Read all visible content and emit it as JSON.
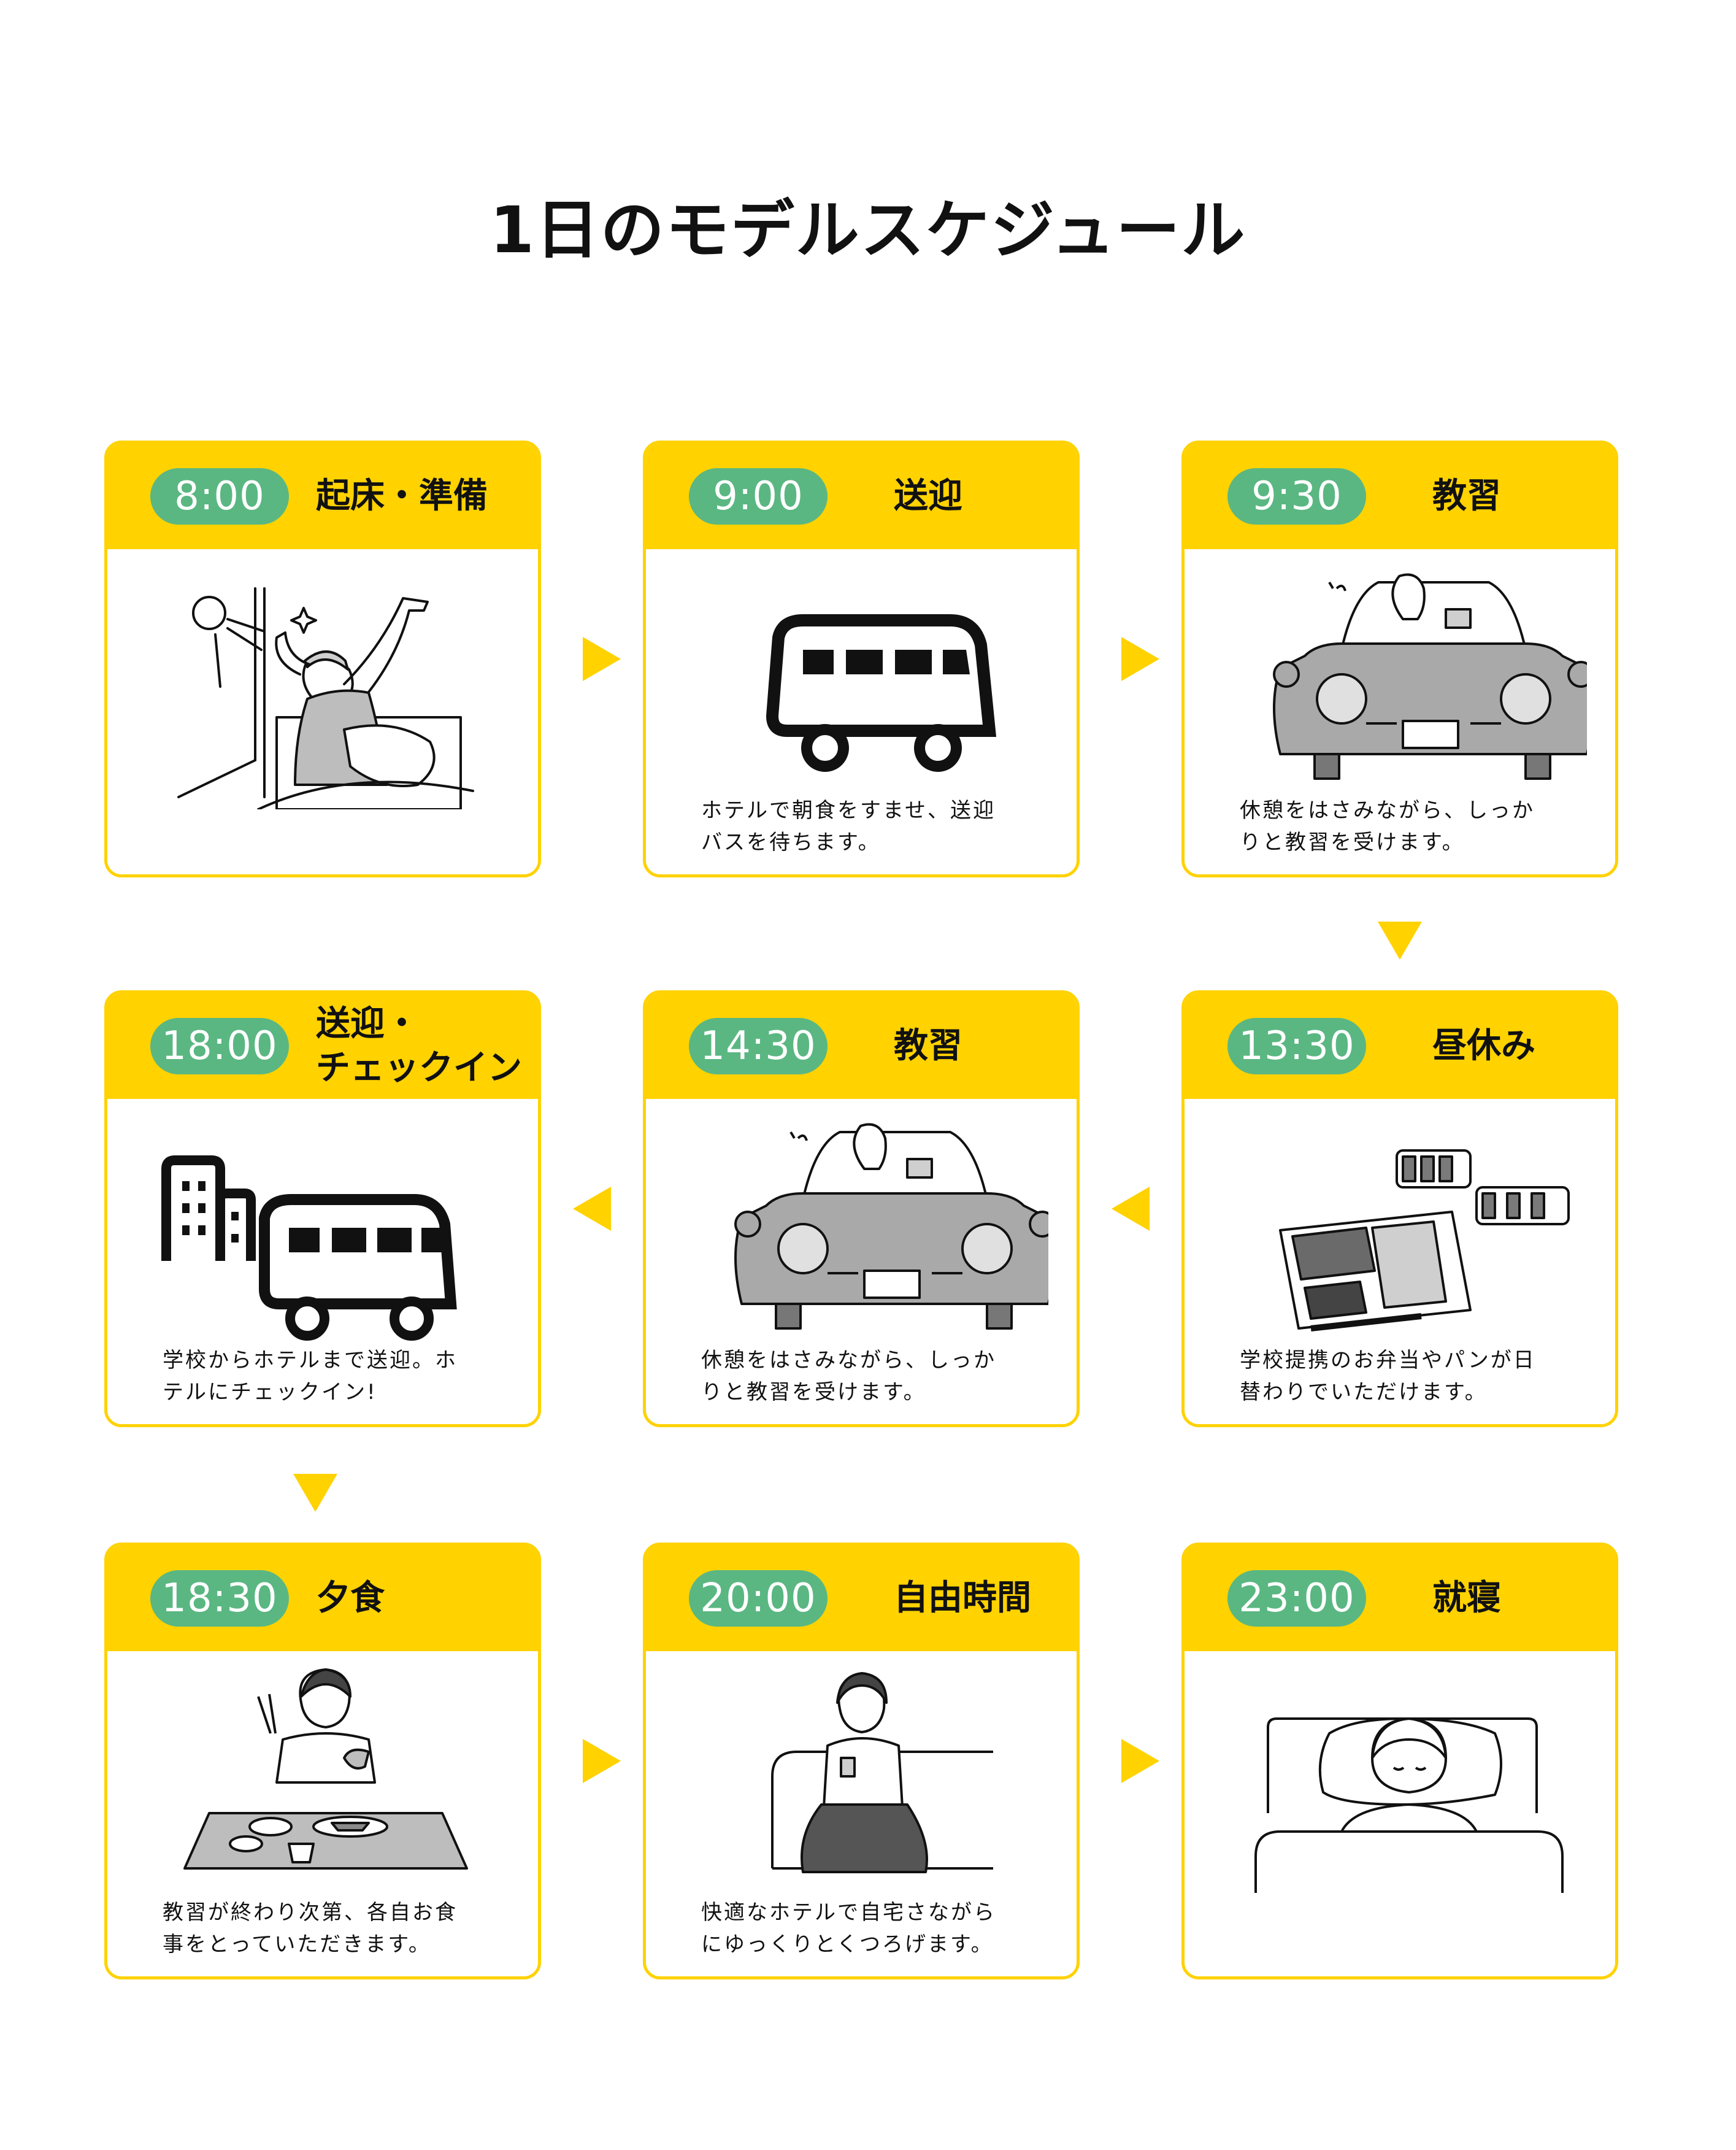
{
  "title": "1日のモデルスケジュール",
  "colors": {
    "accent_yellow": "#ffd200",
    "time_green": "#5ab782"
  },
  "cards": [
    {
      "time": "8:00",
      "activity": "起床・準備",
      "icon": "person-waking-up-illustration",
      "description": ""
    },
    {
      "time": "9:00",
      "activity": "送迎",
      "icon": "bus-icon",
      "description": "ホテルで朝食をすませ、送迎\nバスを待ちます。"
    },
    {
      "time": "9:30",
      "activity": "教習",
      "icon": "person-driving-car-illustration",
      "description": "休憩をはさみながら、しっか\nりと教習を受けます。"
    },
    {
      "time": "13:30",
      "activity": "昼休み",
      "icon": "bento-lunch-illustration",
      "description": "学校提携のお弁当やパンが日\n替わりでいただけます。"
    },
    {
      "time": "14:30",
      "activity": "教習",
      "icon": "person-driving-car-illustration",
      "description": "休憩をはさみながら、しっか\nりと教習を受けます。"
    },
    {
      "time": "18:00",
      "activity": "送迎・\nチェックイン",
      "icon": "building-and-bus-icon",
      "description": "学校からホテルまで送迎。ホ\nテルにチェックイン!"
    },
    {
      "time": "18:30",
      "activity": "夕食",
      "icon": "person-eating-dinner-illustration",
      "description": "教習が終わり次第、各自お食\n事をとっていただきます。"
    },
    {
      "time": "20:00",
      "activity": "自由時間",
      "icon": "person-relaxing-on-sofa-illustration",
      "description": "快適なホテルで自宅さながら\nにゆっくりとくつろげます。"
    },
    {
      "time": "23:00",
      "activity": "就寝",
      "icon": "person-sleeping-in-bed-illustration",
      "description": ""
    }
  ]
}
